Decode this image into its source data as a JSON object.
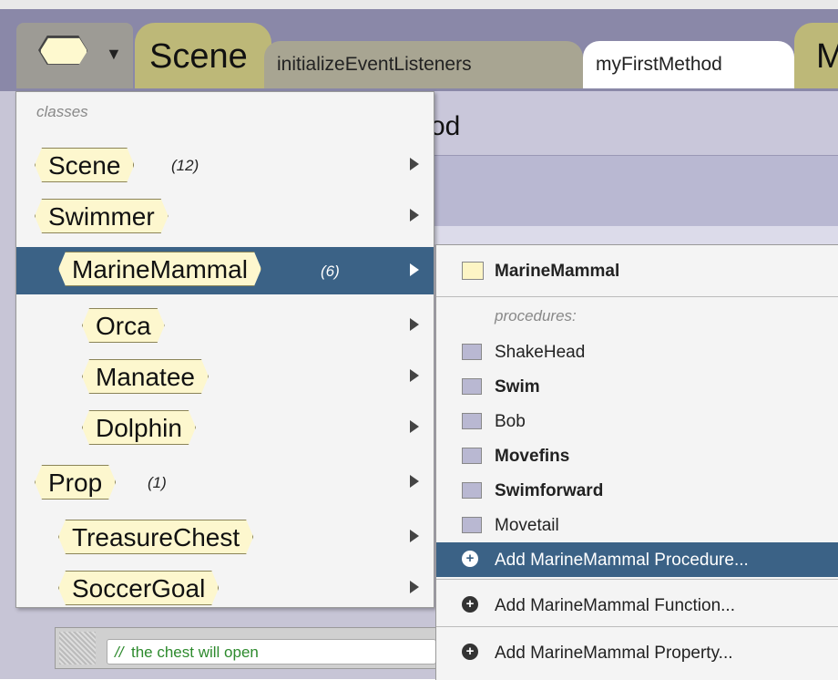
{
  "tabs": {
    "scene": "Scene",
    "initialize": "initializeEventListeners",
    "my_first_method": "myFirstMethod",
    "more": "M"
  },
  "editor": {
    "method_title_fragment": "od",
    "comment_prefix": "//",
    "comment_text": "the chest will open"
  },
  "class_menu": {
    "header": "classes",
    "items": [
      {
        "label": "Scene",
        "count": "(12)"
      },
      {
        "label": "Swimmer",
        "count": ""
      },
      {
        "label": "MarineMammal",
        "count": "(6)"
      },
      {
        "label": "Orca",
        "count": ""
      },
      {
        "label": "Manatee",
        "count": ""
      },
      {
        "label": "Dolphin",
        "count": ""
      },
      {
        "label": "Prop",
        "count": "(1)"
      },
      {
        "label": "TreasureChest",
        "count": ""
      },
      {
        "label": "SoccerGoal",
        "count": ""
      }
    ]
  },
  "submenu": {
    "title": "MarineMammal",
    "procedures_header": "procedures:",
    "procedures": [
      "ShakeHead",
      "Swim",
      "Bob",
      "Movefins",
      "Swimforward",
      "Movetail"
    ],
    "add_procedure": "Add MarineMammal Procedure...",
    "add_function": "Add MarineMammal Function...",
    "add_property": "Add MarineMammal Property..."
  },
  "colors": {
    "selection": "#3b6286",
    "tab_bar": "#8a88a8",
    "class_hex_fill": "#fdf7ce"
  }
}
